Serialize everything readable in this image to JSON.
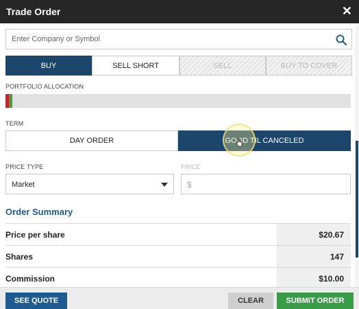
{
  "dialog": {
    "title": "Trade Order"
  },
  "search": {
    "placeholder": "Enter Company or Symbol"
  },
  "action_tabs": [
    {
      "label": "BUY",
      "selected": true,
      "enabled": true
    },
    {
      "label": "SELL SHORT",
      "selected": false,
      "enabled": true
    },
    {
      "label": "SELL",
      "selected": false,
      "enabled": false
    },
    {
      "label": "BUY TO COVER",
      "selected": false,
      "enabled": false
    }
  ],
  "portfolio": {
    "label": "PORTFOLIO ALLOCATION",
    "segments": [
      {
        "color": "#c0272d",
        "fraction": 0.01
      },
      {
        "color": "#4d9a3c",
        "fraction": 0.01
      }
    ]
  },
  "term": {
    "label": "TERM",
    "options": [
      "DAY ORDER",
      "GOOD TIL CANCELED"
    ],
    "selected": "GOOD TIL CANCELED"
  },
  "price_type": {
    "label": "PRICE TYPE",
    "value": "Market"
  },
  "price": {
    "label": "PRICE",
    "prefix": "$",
    "value": ""
  },
  "summary": {
    "title": "Order Summary",
    "rows": [
      {
        "label": "Price per share",
        "value": "$20.67"
      },
      {
        "label": "Shares",
        "value": "147"
      },
      {
        "label": "Commission",
        "value": "$10.00"
      }
    ]
  },
  "buttons": {
    "see_quote": "SEE QUOTE",
    "clear": "CLEAR",
    "submit": "SUBMIT ORDER"
  },
  "colors": {
    "primary": "#1d466c",
    "accent": "#1d5b91",
    "submit": "#3a9c48",
    "titlebar": "#262626"
  },
  "icons": {
    "close": "close-icon",
    "search": "search-icon",
    "dropdown": "chevron-down-icon"
  }
}
